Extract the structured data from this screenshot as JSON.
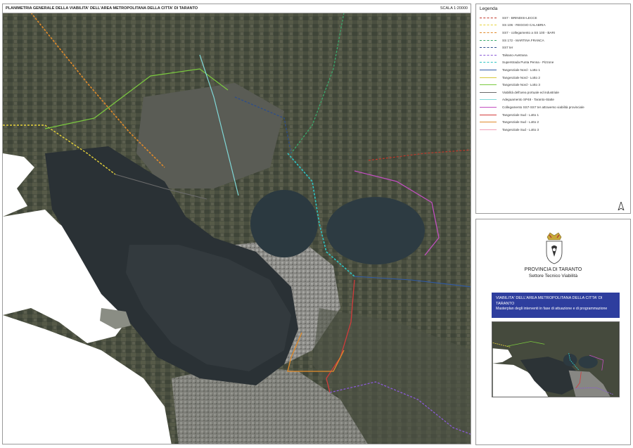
{
  "map": {
    "title": "PLANIMETRIA GENERALE DELLA VIABILITA' DELL'AREA METROPOLITANA DELLA CITTA' DI TARANTO",
    "scale": "SCALA 1:20000"
  },
  "legend": {
    "title": "Legenda",
    "items": [
      {
        "label": "SS7 - BRINDISI-LECCE",
        "color": "#c0392b",
        "style": "dashed"
      },
      {
        "label": "SS 106 - REGGIO CALABRIA",
        "color": "#e6d23a",
        "style": "dashed"
      },
      {
        "label": "SS7 - collegamento a SS 100 - BARI",
        "color": "#e08a2a",
        "style": "dashed"
      },
      {
        "label": "SS 172 - MARTINA FRANCA",
        "color": "#3aa86b",
        "style": "dashed"
      },
      {
        "label": "SS7 ter",
        "color": "#2d4d8a",
        "style": "dashed"
      },
      {
        "label": "Talsano-Avetrana",
        "color": "#8a5ad6",
        "style": "dashed"
      },
      {
        "label": "Superstrada Punta Penna - Pizzone",
        "color": "#2ec4c4",
        "style": "dashed"
      },
      {
        "label": "Tangenziale Nord - Lotto 1",
        "color": "#2f5aa8",
        "style": "solid"
      },
      {
        "label": "Tangenziale Nord - Lotto 2",
        "color": "#d6c83a",
        "style": "solid"
      },
      {
        "label": "Tangenziale Nord - Lotto 3",
        "color": "#7ac93e",
        "style": "solid"
      },
      {
        "label": "Viabilità dell'area portuale ed industriale",
        "color": "#6a6a6a",
        "style": "solid"
      },
      {
        "label": "Adeguamento SP48 - Taranto-Statte",
        "color": "#7fd8d8",
        "style": "solid"
      },
      {
        "label": "Collegamento SS7-SS7 ter attraverso viabilità provinciale",
        "color": "#c24fc0",
        "style": "solid"
      },
      {
        "label": "Tangenziale Sud - Lotto 1",
        "color": "#d23b3b",
        "style": "solid"
      },
      {
        "label": "Tangenziale Sud - Lotto 2",
        "color": "#e08a2a",
        "style": "solid"
      },
      {
        "label": "Tangenziale Sud - Lotto 3",
        "color": "#f0a0b8",
        "style": "solid"
      }
    ]
  },
  "info": {
    "org_name": "PROVINCIA DI TARANTO",
    "org_sub": "Settore Tecnico Viabilità",
    "project_title": "VIABILITA' DELL'AREA METROPOLITANA DELLA CITTA' DI TARANTO",
    "project_sub": "Masterplan degli interventi in fase di attuazione e di programmazione",
    "accent_color": "#2e3e9e"
  },
  "icons": {
    "north_arrow": "north-arrow-icon",
    "crest": "coat-of-arms-icon"
  }
}
